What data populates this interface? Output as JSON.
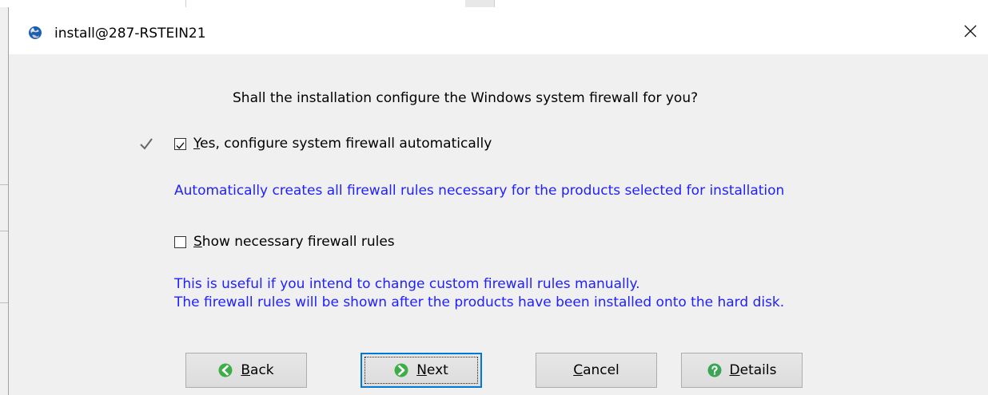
{
  "window": {
    "title": "install@287-RSTEIN21",
    "close_glyph": "✕"
  },
  "main": {
    "question": "Shall the installation configure the Windows system firewall for you?",
    "option_auto": {
      "hotkey": "Y",
      "label_rest": "es, configure system firewall automatically",
      "checked": true
    },
    "auto_description": "Automatically creates all firewall rules necessary for the products selected for installation",
    "option_show": {
      "hotkey": "S",
      "label_rest": "how necessary firewall rules",
      "checked": false
    },
    "show_description_1": "This is useful if you intend to change custom firewall rules manually.",
    "show_description_2": "The firewall rules will be shown after the products have been installed onto the hard disk."
  },
  "buttons": {
    "back": {
      "hotkey": "B",
      "label_rest": "ack",
      "icon": "arrow-left-circle-icon"
    },
    "next": {
      "hotkey": "N",
      "label_rest": "ext",
      "icon": "arrow-right-circle-icon"
    },
    "cancel": {
      "hotkey": "C",
      "label_rest": "ancel"
    },
    "details": {
      "hotkey": "D",
      "label_rest": "etails",
      "icon": "help-circle-icon"
    }
  },
  "colors": {
    "description_text": "#1f1fff",
    "nav_icon_green": "#3fae49",
    "help_icon_green": "#3aa655",
    "focus_border": "#0078d7"
  }
}
